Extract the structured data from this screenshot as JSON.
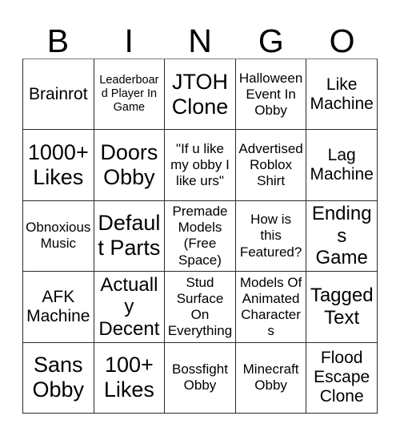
{
  "card": {
    "title": "BINGO",
    "header_letters": [
      "B",
      "I",
      "N",
      "G",
      "O"
    ],
    "columns": 5,
    "rows": 5,
    "colors": {
      "background": "#ffffff",
      "text": "#000000",
      "border": "#2b2b2b"
    },
    "cells": [
      {
        "text": "Brainrot",
        "row": 1,
        "col": 1,
        "column_letter": "B",
        "size": "fs-lg",
        "free_space": false
      },
      {
        "text": "Leaderboard Player In Game",
        "row": 1,
        "col": 2,
        "column_letter": "I",
        "size": "fs-sm",
        "free_space": false
      },
      {
        "text": "JTOH Clone",
        "row": 1,
        "col": 3,
        "column_letter": "N",
        "size": "fs-xxl",
        "free_space": false
      },
      {
        "text": "Halloween Event In Obby",
        "row": 1,
        "col": 4,
        "column_letter": "G",
        "size": "fs-md",
        "free_space": false
      },
      {
        "text": "Like Machine",
        "row": 1,
        "col": 5,
        "column_letter": "O",
        "size": "fs-lg",
        "free_space": false
      },
      {
        "text": "1000+ Likes",
        "row": 2,
        "col": 1,
        "column_letter": "B",
        "size": "fs-xxl",
        "free_space": false
      },
      {
        "text": "Doors Obby",
        "row": 2,
        "col": 2,
        "column_letter": "I",
        "size": "fs-xxl",
        "free_space": false
      },
      {
        "text": "\"If u like my obby I like urs\"",
        "row": 2,
        "col": 3,
        "column_letter": "N",
        "size": "fs-md",
        "free_space": false
      },
      {
        "text": "Advertised Roblox Shirt",
        "row": 2,
        "col": 4,
        "column_letter": "G",
        "size": "fs-md",
        "free_space": false
      },
      {
        "text": "Lag Machine",
        "row": 2,
        "col": 5,
        "column_letter": "O",
        "size": "fs-lg",
        "free_space": false
      },
      {
        "text": "Obnoxious Music",
        "row": 3,
        "col": 1,
        "column_letter": "B",
        "size": "fs-md",
        "free_space": false
      },
      {
        "text": "Default Parts",
        "row": 3,
        "col": 2,
        "column_letter": "I",
        "size": "fs-xxl",
        "free_space": false
      },
      {
        "text": "Premade Models (Free Space)",
        "row": 3,
        "col": 3,
        "column_letter": "N",
        "size": "fs-md",
        "free_space": true
      },
      {
        "text": "How is this Featured?",
        "row": 3,
        "col": 4,
        "column_letter": "G",
        "size": "fs-md",
        "free_space": false
      },
      {
        "text": "Endings Game",
        "row": 3,
        "col": 5,
        "column_letter": "O",
        "size": "fs-xl",
        "free_space": false
      },
      {
        "text": "AFK Machine",
        "row": 4,
        "col": 1,
        "column_letter": "B",
        "size": "fs-lg",
        "free_space": false
      },
      {
        "text": "Actually Decent",
        "row": 4,
        "col": 2,
        "column_letter": "I",
        "size": "fs-xl",
        "free_space": false
      },
      {
        "text": "Stud Surface On Everything",
        "row": 4,
        "col": 3,
        "column_letter": "N",
        "size": "fs-md",
        "free_space": false
      },
      {
        "text": "Models Of Animated Characters",
        "row": 4,
        "col": 4,
        "column_letter": "G",
        "size": "fs-md",
        "free_space": false
      },
      {
        "text": "Tagged Text",
        "row": 4,
        "col": 5,
        "column_letter": "O",
        "size": "fs-xl",
        "free_space": false
      },
      {
        "text": "Sans Obby",
        "row": 5,
        "col": 1,
        "column_letter": "B",
        "size": "fs-xxl",
        "free_space": false
      },
      {
        "text": "100+ Likes",
        "row": 5,
        "col": 2,
        "column_letter": "I",
        "size": "fs-xxl",
        "free_space": false
      },
      {
        "text": "Bossfight Obby",
        "row": 5,
        "col": 3,
        "column_letter": "N",
        "size": "fs-md",
        "free_space": false
      },
      {
        "text": "Minecraft Obby",
        "row": 5,
        "col": 4,
        "column_letter": "G",
        "size": "fs-md",
        "free_space": false
      },
      {
        "text": "Flood Escape Clone",
        "row": 5,
        "col": 5,
        "column_letter": "O",
        "size": "fs-lg",
        "free_space": false
      }
    ]
  }
}
